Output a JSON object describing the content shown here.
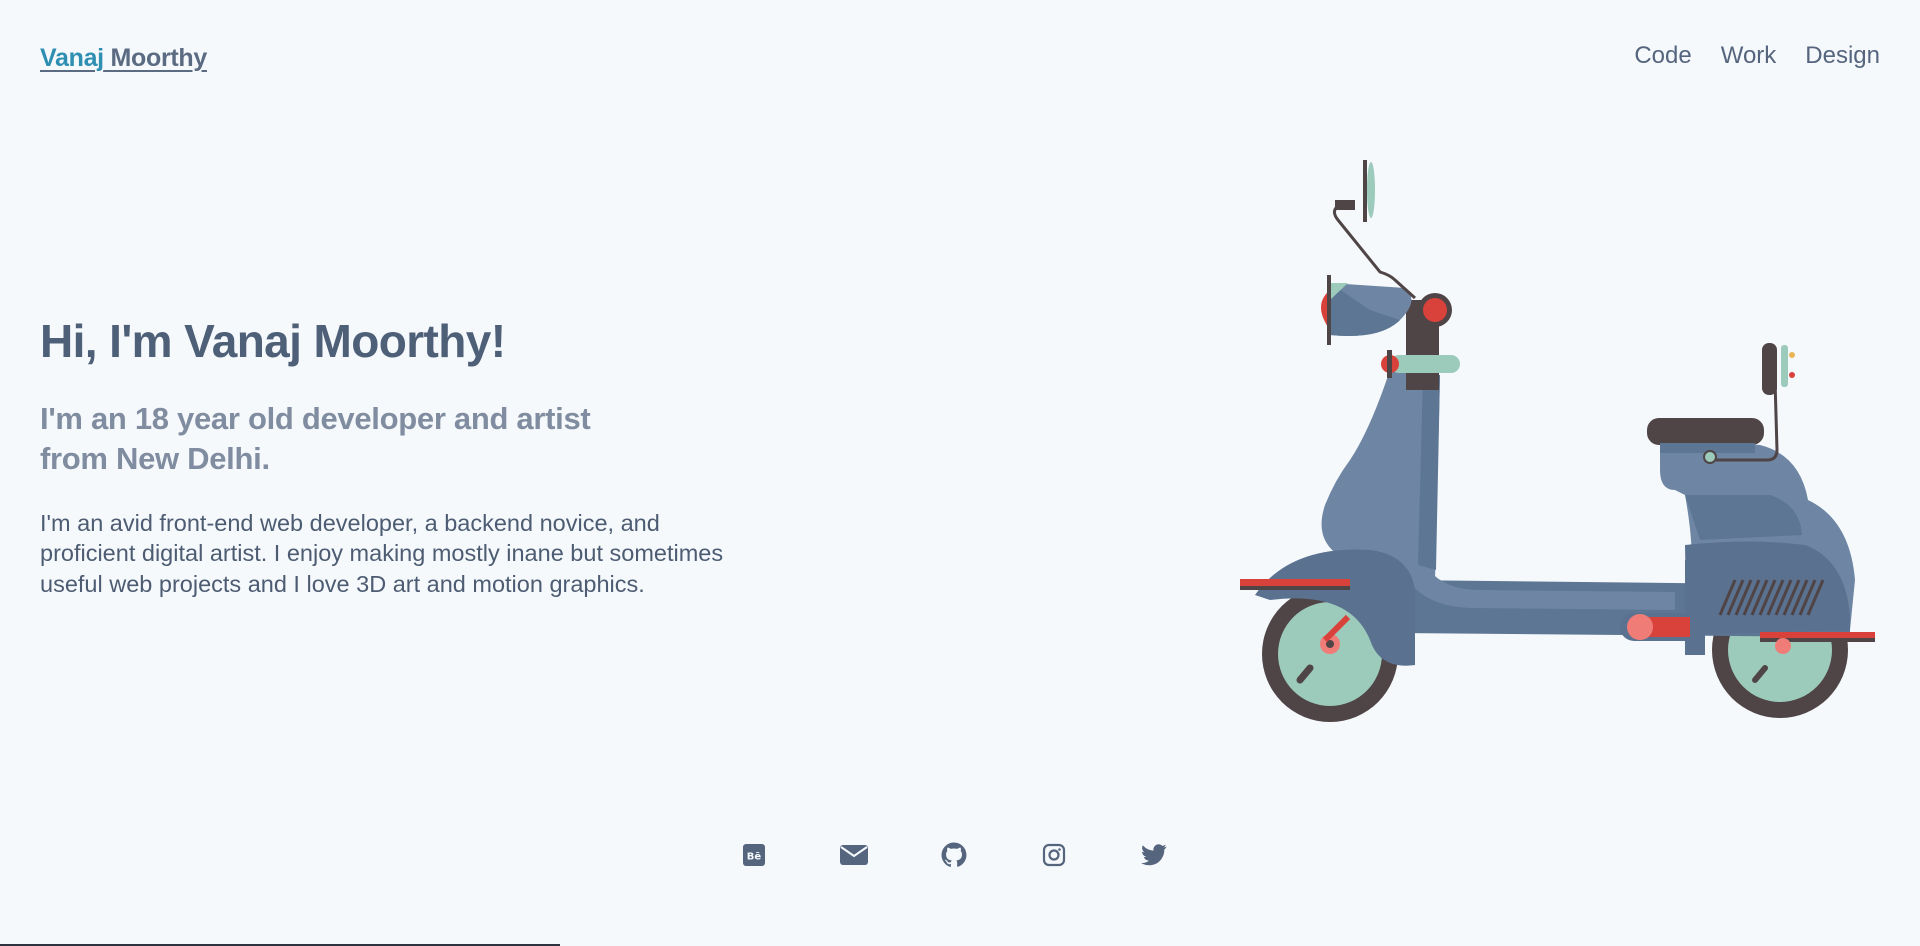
{
  "header": {
    "brand_first": "Vanaj",
    "brand_last": " Moorthy",
    "nav": [
      {
        "label": "Code"
      },
      {
        "label": "Work"
      },
      {
        "label": "Design"
      }
    ]
  },
  "hero": {
    "title": "Hi, I'm Vanaj Moorthy!",
    "subtitle": "I'm an 18 year old developer and artist from New Delhi.",
    "body": "I'm an avid front-end web developer, a backend novice, and proficient digital artist. I enjoy making mostly inane but sometimes useful web projects and I love 3D art and motion graphics."
  },
  "social": [
    {
      "icon": "behance-icon"
    },
    {
      "icon": "mail-icon"
    },
    {
      "icon": "github-icon"
    },
    {
      "icon": "instagram-icon"
    },
    {
      "icon": "twitter-icon"
    }
  ],
  "colors": {
    "background": "#f5f9fc",
    "accent": "#2e8fb3",
    "text": "#56657e",
    "scooter_body": "#6e86a3",
    "scooter_mint": "#9ccabb",
    "scooter_red": "#d9423b"
  }
}
